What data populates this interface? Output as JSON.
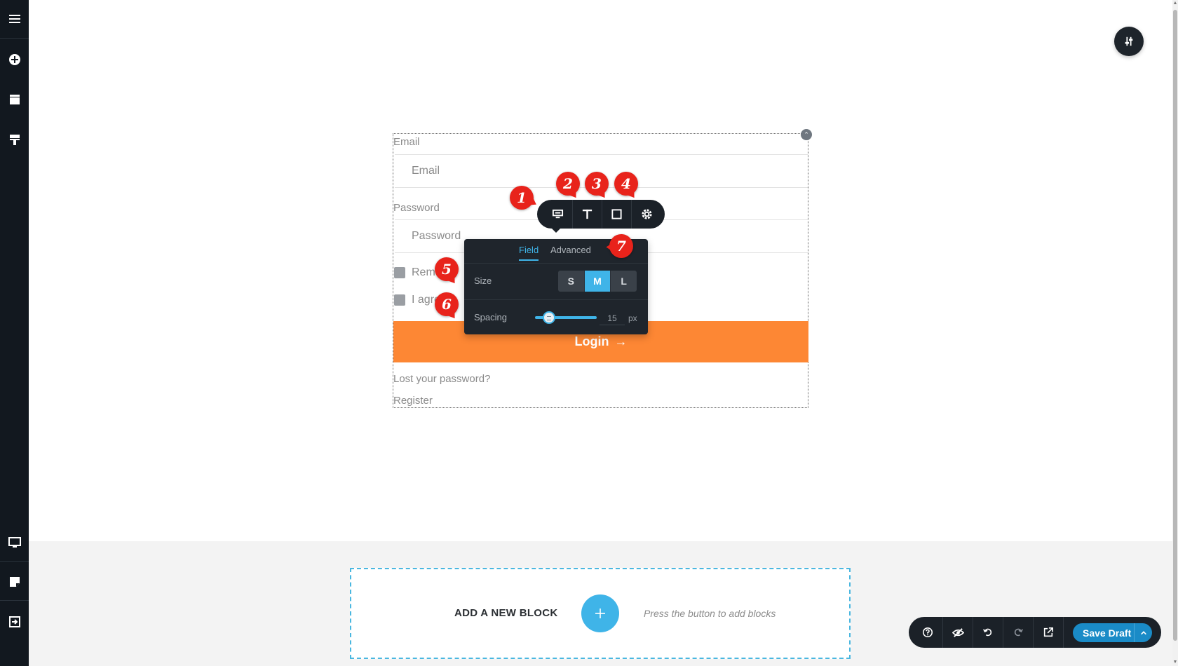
{
  "sidebar": {
    "top_icons": [
      "menu-icon",
      "add-circle-icon",
      "layers-icon",
      "paint-roller-icon"
    ],
    "bottom_icons": [
      "desktop-icon",
      "page-settings-icon",
      "exit-icon"
    ]
  },
  "form": {
    "email_label": "Email",
    "email_placeholder": "Email",
    "password_label": "Password",
    "password_placeholder": "Password",
    "remember_label": "Reme",
    "agree_label": "I agre",
    "login_label": "Login",
    "login_arrow": "→",
    "lost_password_link": "Lost your password?",
    "register_link": "Register"
  },
  "toolbar": {
    "buttons": [
      "field-style-icon",
      "text-icon",
      "border-icon",
      "gear-icon"
    ]
  },
  "popover": {
    "tabs": [
      {
        "label": "Field",
        "active": true
      },
      {
        "label": "Advanced",
        "active": false
      }
    ],
    "size_label": "Size",
    "size_options": [
      "S",
      "M",
      "L"
    ],
    "size_selected": "M",
    "spacing_label": "Spacing",
    "spacing_value": "15",
    "spacing_unit": "px"
  },
  "markers": [
    "1",
    "2",
    "3",
    "4",
    "5",
    "6",
    "7"
  ],
  "add_block": {
    "title": "ADD A NEW BLOCK",
    "hint": "Press the button to add blocks"
  },
  "actionbar": {
    "icons": [
      "help-icon",
      "visibility-off-icon",
      "undo-icon",
      "redo-icon",
      "external-link-icon"
    ],
    "save_label": "Save Draft"
  },
  "colors": {
    "accent": "#3fb4e8",
    "login": "#fd8734",
    "marker": "#e8231b",
    "dark": "#1b2128",
    "save": "#1a8bc7"
  }
}
